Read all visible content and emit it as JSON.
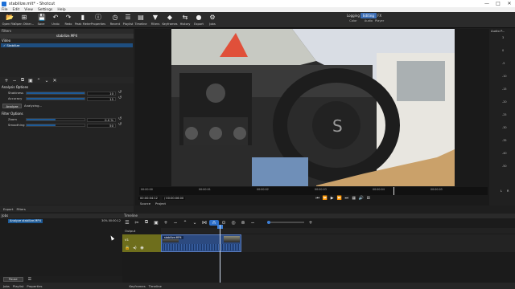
{
  "window": {
    "title": "stabilize.mlt* - Shotcut",
    "controls": [
      "—",
      "□",
      "✕"
    ]
  },
  "menu": [
    "File",
    "Edit",
    "View",
    "Settings",
    "Help"
  ],
  "toolbar": {
    "buttons": [
      {
        "label": "Open File",
        "icon": "folder-open-icon",
        "glyph": "📂"
      },
      {
        "label": "Open Other...",
        "icon": "open-other-icon",
        "glyph": "⊞"
      },
      {
        "label": "Save",
        "icon": "save-icon",
        "glyph": "💾"
      },
      {
        "label": "Undo",
        "icon": "undo-icon",
        "glyph": "↶"
      },
      {
        "label": "Redo",
        "icon": "redo-icon",
        "glyph": "↷"
      },
      {
        "label": "Peak Meter",
        "icon": "peak-meter-icon",
        "glyph": "▮"
      },
      {
        "label": "Properties",
        "icon": "properties-icon",
        "glyph": "ⓘ"
      },
      {
        "label": "Recent",
        "icon": "recent-icon",
        "glyph": "◷"
      },
      {
        "label": "Playlist",
        "icon": "playlist-icon",
        "glyph": "☰"
      },
      {
        "label": "Timeline",
        "icon": "timeline-icon",
        "glyph": "▤"
      },
      {
        "label": "Filters",
        "icon": "filters-icon",
        "glyph": "▼"
      },
      {
        "label": "Keyframes",
        "icon": "keyframes-icon",
        "glyph": "◆"
      },
      {
        "label": "History",
        "icon": "history-icon",
        "glyph": "⇆"
      },
      {
        "label": "Export",
        "icon": "export-icon",
        "glyph": "●"
      },
      {
        "label": "Jobs",
        "icon": "jobs-icon",
        "glyph": "⚙"
      }
    ],
    "layouts": [
      {
        "label": "Logging",
        "sub": "Color",
        "active": false
      },
      {
        "label": "Editing",
        "sub": "Audio",
        "active": true
      },
      {
        "label": "FX",
        "sub": "Player",
        "active": false
      }
    ]
  },
  "filters": {
    "panel_title": "Filters",
    "clip_name": "stabilize.MP4",
    "section_video": "Video",
    "filter_item": "✓  Stabilize",
    "tools": [
      "+",
      "−",
      "⧉",
      "▣",
      "⌃",
      "⌄",
      "✕"
    ],
    "analysis_title": "Analysis Options",
    "shakiness": {
      "label": "Shakiness",
      "value": "10",
      "level": 1.0
    },
    "accuracy": {
      "label": "Accuracy",
      "value": "15",
      "level": 1.0
    },
    "analyze_label": "Analyze",
    "analyzing_label": "Analyzing...",
    "filter_title": "Filter Options",
    "zoom": {
      "label": "Zoom",
      "value": "0.0",
      "unit": "%",
      "level": 0.5
    },
    "smoothing": {
      "label": "Smoothing",
      "value": "50",
      "level": 0.5
    }
  },
  "viewer": {
    "ticks": [
      "00:00:00",
      "00:00:01",
      "00:00:02",
      "00:00:03",
      "00:00:04",
      "00:00:05"
    ],
    "timecode_current": "00:00:04:12",
    "timecode_total": "/ 00:00:06:00",
    "controls": [
      "⏮",
      "⏪",
      "▶",
      "⏩",
      "⏭",
      "▦",
      "🔊",
      "⊞"
    ],
    "tabs": [
      "Source",
      "Project"
    ]
  },
  "audio_meter": {
    "title": "Audio P...",
    "ticks": [
      "3",
      "0",
      "-5",
      "-10",
      "-15",
      "-20",
      "-25",
      "-30",
      "-35",
      "-40",
      "-50"
    ],
    "left": "L",
    "right": "R"
  },
  "left_tabs": [
    "Export",
    "Filters"
  ],
  "jobs": {
    "title": "Jobs",
    "job": {
      "name": "Analyze stabilize.MP4",
      "progress": "30% 00:00:12"
    },
    "pause": "Pause",
    "menu_glyph": "☰"
  },
  "bottom_tabs": [
    "Jobs",
    "Playlist",
    "Properties"
  ],
  "timeline": {
    "title": "Timeline",
    "tools": [
      "☰",
      "✂",
      "⧉",
      "▣",
      "+",
      "−",
      "⌃",
      "⌄",
      "⋈",
      "∩",
      "⊙",
      "◎",
      "⊚",
      "−"
    ],
    "output": "Output",
    "track": "V1",
    "clip_label": "stabilize.MP4"
  },
  "bottom_right_tabs": [
    "Keyframes",
    "Timeline"
  ],
  "colors": {
    "accent": "#1e5a96",
    "track_head": "#6e6e1c",
    "clip": "#2c4a80"
  }
}
